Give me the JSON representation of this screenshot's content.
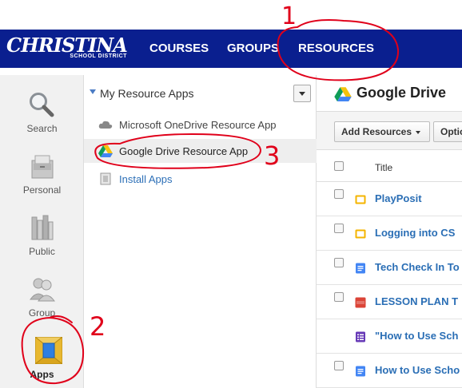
{
  "brand": {
    "name": "CHRISTINA",
    "subtitle": "SCHOOL DISTRICT"
  },
  "nav": {
    "items": [
      {
        "label": "COURSES"
      },
      {
        "label": "GROUPS"
      },
      {
        "label": "RESOURCES"
      }
    ]
  },
  "rail": {
    "items": [
      {
        "label": "Search",
        "icon": "magnifier-icon"
      },
      {
        "label": "Personal",
        "icon": "cabinet-icon"
      },
      {
        "label": "Public",
        "icon": "books-icon"
      },
      {
        "label": "Group",
        "icon": "people-icon"
      },
      {
        "label": "Apps",
        "icon": "apps-icon",
        "active": true
      }
    ]
  },
  "resource_apps": {
    "title": "My Resource Apps",
    "items": [
      {
        "label": "Microsoft OneDrive Resource App",
        "icon": "cloud-icon"
      },
      {
        "label": "Google Drive Resource App",
        "icon": "google-drive-icon",
        "selected": true
      },
      {
        "label": "Install Apps",
        "icon": "install-icon",
        "link": true
      }
    ]
  },
  "drive": {
    "title": "Google Drive",
    "toolbar": {
      "add_label": "Add Resources",
      "options_label": "Optio"
    },
    "columns": {
      "title": "Title"
    },
    "rows": [
      {
        "title": "PlayPosit",
        "icon": "slides-icon"
      },
      {
        "title": "Logging into CS",
        "icon": "slides-icon"
      },
      {
        "title": "Tech Check In To",
        "icon": "docs-icon"
      },
      {
        "title": "LESSON PLAN T",
        "icon": "pdf-icon"
      },
      {
        "title": "\"How to Use Sch",
        "icon": "forms-icon"
      },
      {
        "title": "How to Use Scho",
        "icon": "docs-icon"
      }
    ]
  },
  "annotations": {
    "one": "1",
    "two": "2",
    "three": "3"
  },
  "colors": {
    "navband": "#0a1f8f",
    "link": "#2a6eb5",
    "annotation": "#e0001a"
  }
}
